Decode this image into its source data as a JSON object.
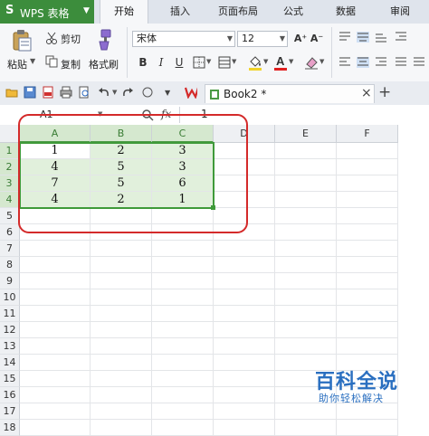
{
  "app": {
    "logo": "S",
    "name": "WPS 表格"
  },
  "tabs": [
    {
      "label": "开始",
      "active": true
    },
    {
      "label": "插入",
      "active": false
    },
    {
      "label": "页面布局",
      "active": false
    },
    {
      "label": "公式",
      "active": false
    },
    {
      "label": "数据",
      "active": false
    },
    {
      "label": "审阅",
      "active": false
    }
  ],
  "ribbon": {
    "paste_label": "粘贴",
    "cut_label": "剪切",
    "copy_label": "复制",
    "format_painter_label": "格式刷",
    "font_name": "宋体",
    "font_size": "12",
    "bold": "B",
    "italic": "I",
    "underline": "U",
    "increase_font": "A⁺",
    "decrease_font": "A⁻"
  },
  "quickbar": {
    "doc_tab": "Book2 *",
    "close_symbol": "×",
    "new_tab_symbol": "+"
  },
  "formula_bar": {
    "name_box": "A1",
    "fx_label": "fx",
    "value": "1"
  },
  "sheet": {
    "columns": [
      "A",
      "B",
      "C",
      "D",
      "E",
      "F"
    ],
    "rows": [
      "1",
      "2",
      "3",
      "4",
      "5",
      "6",
      "7",
      "8",
      "9",
      "10",
      "11",
      "12",
      "13",
      "14",
      "15",
      "16",
      "17",
      "18"
    ],
    "cells": [
      [
        "1",
        "2",
        "3"
      ],
      [
        "4",
        "5",
        "3"
      ],
      [
        "7",
        "5",
        "6"
      ],
      [
        "4",
        "2",
        "1"
      ]
    ]
  },
  "watermark": {
    "title": "百科全说",
    "subtitle": "助你轻松解决"
  },
  "colors": {
    "brand_green": "#3c8d3c",
    "selection_green": "#3f9a3a",
    "annotation_red": "#d42a2a",
    "watermark_blue": "#2a6fc0"
  }
}
